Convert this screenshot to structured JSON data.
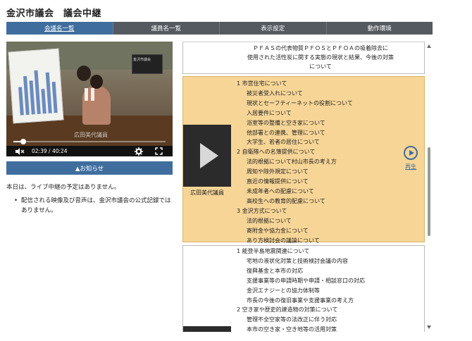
{
  "header": {
    "title": "金沢市議会　議会中継"
  },
  "nav": {
    "tabs": [
      {
        "label": "会議名一覧",
        "active": true
      },
      {
        "label": "議員名一覧",
        "active": false
      },
      {
        "label": "表示設定",
        "active": false
      },
      {
        "label": "動作環境",
        "active": false
      }
    ]
  },
  "player": {
    "caption": "広田美代議員",
    "screen_label": "金沢市議会",
    "time_current": "02:39",
    "time_separator": "/",
    "time_total": "40:24",
    "progress_fraction": 0.066,
    "icons": {
      "volume": "volume-muted-icon",
      "settings": "gear-icon",
      "fullscreen": "fullscreen-icon",
      "pause": "pause-icon"
    }
  },
  "notice": {
    "label": "▲お知らせ"
  },
  "info": {
    "text": "本日は、ライブ中継の予定はありません。",
    "bullets": [
      "配信される映像及び音声は、金沢市議会の公式記録ではありません。"
    ]
  },
  "entries": [
    {
      "lines": [
        "ＰＦＡＳの代表物質ＰＦＯＳとＰＦＯＡの吸着除去に",
        "使用された活性炭に関する実態の現状と結果、今後の対策",
        "について"
      ]
    },
    {
      "speaker": "広田美代議員",
      "replay_label": "再生",
      "lines": [
        "1  市営住宅について",
        "被災者受入れについて",
        "現状とセーフティーネットの役割について",
        "入居要件について",
        "浴室等の整備と空き家について",
        "他部署との連携、管理について",
        "大学生、若者の居住について",
        "2  自衛隊への名簿提供について",
        "法的根拠について村山市長の考え方",
        "周知や除外規定について",
        "直近の情報提供について",
        "未成年者への配慮について",
        "高校生への教育的配慮について",
        "3  金沢方式について",
        "法的根拠について",
        "寄附金や協力金について",
        "あり方検討会の議論について"
      ]
    },
    {
      "lines": [
        "1  能登半島地震関連について",
        "宅地の液状化対策と技術検討会議の内容",
        "復興基金と本市の対応",
        "支援事業等の申請時期や申請・相談窓口の対応",
        "金沢エナジーとの協力体制等",
        "市長の今後の復旧事業や支援事業の考え方",
        "2  空き家や歴史的建造物の対策について",
        "管理不全空家等の法改正に伴う対応",
        "本市の空き家・空き地等の活用対策"
      ]
    }
  ]
}
